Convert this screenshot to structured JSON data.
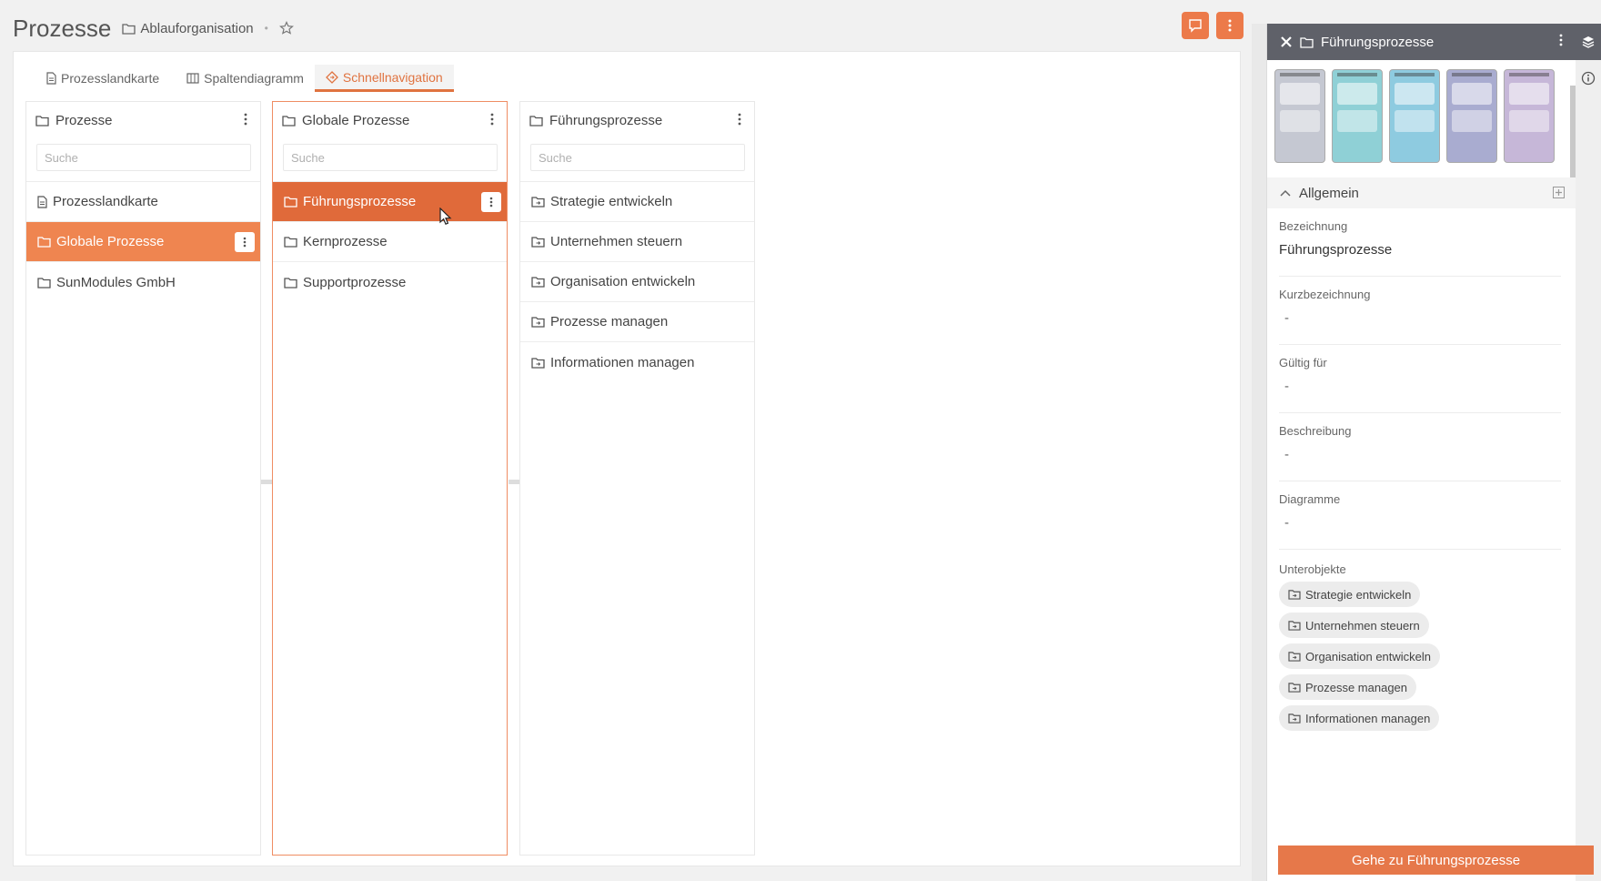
{
  "header": {
    "title": "Prozesse",
    "breadcrumb": "Ablauforganisation",
    "separator": "•"
  },
  "tabs": [
    {
      "label": "Prozesslandkarte",
      "icon": "document-icon"
    },
    {
      "label": "Spaltendiagramm",
      "icon": "columns-icon"
    },
    {
      "label": "Schnellnavigation",
      "icon": "diamond-icon",
      "active": true
    }
  ],
  "columns": [
    {
      "title": "Prozesse",
      "search_placeholder": "Suche",
      "items": [
        "Prozesslandkarte",
        "Globale Prozesse",
        "SunModules GmbH"
      ]
    },
    {
      "title": "Globale Prozesse",
      "search_placeholder": "Suche",
      "items": [
        "Führungsprozesse",
        "Kernprozesse",
        "Supportprozesse"
      ]
    },
    {
      "title": "Führungsprozesse",
      "search_placeholder": "Suche",
      "items": [
        "Strategie entwickeln",
        "Unternehmen steuern",
        "Organisation entwickeln",
        "Prozesse managen",
        "Informationen managen"
      ]
    }
  ],
  "panel": {
    "title": "Führungsprozesse",
    "thumbnails": [
      {
        "color": "#c5c8d2"
      },
      {
        "color": "#8fd0d6"
      },
      {
        "color": "#8ecbe0"
      },
      {
        "color": "#a9acd0"
      },
      {
        "color": "#c6b7d8"
      }
    ],
    "section": "Allgemein",
    "fields": [
      {
        "label": "Bezeichnung",
        "value": "Führungsprozesse"
      },
      {
        "label": "Kurzbezeichnung",
        "value": "-"
      },
      {
        "label": "Gültig für",
        "value": "-"
      },
      {
        "label": "Beschreibung",
        "value": "-"
      },
      {
        "label": "Diagramme",
        "value": "-"
      }
    ],
    "sub_label": "Unterobjekte",
    "chips": [
      "Strategie entwickeln",
      "Unternehmen steuern",
      "Organisation entwickeln",
      "Prozesse managen",
      "Informationen managen"
    ],
    "goto_label": "Gehe zu Führungsprozesse"
  },
  "colors": {
    "accent": "#ef8550",
    "accent_dark": "#e06a3a",
    "panel_header": "#5f6169"
  }
}
